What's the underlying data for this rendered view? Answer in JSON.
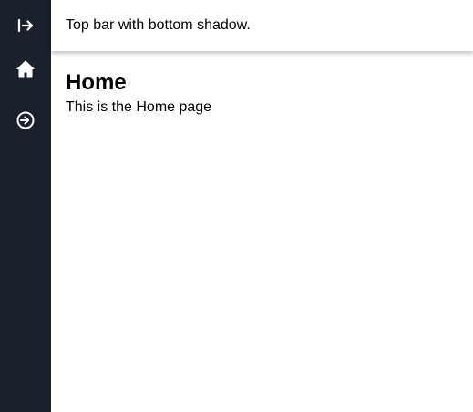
{
  "sidebar": {
    "items": [
      {
        "name": "expand",
        "icon": "arrow-right-to-bar-icon"
      },
      {
        "name": "home",
        "icon": "home-icon"
      },
      {
        "name": "login",
        "icon": "sign-in-icon"
      }
    ],
    "background": "#1a202c",
    "icon_color": "#ffffff"
  },
  "topbar": {
    "text": "Top bar with bottom shadow."
  },
  "main": {
    "title": "Home",
    "text": "This is the Home page"
  }
}
